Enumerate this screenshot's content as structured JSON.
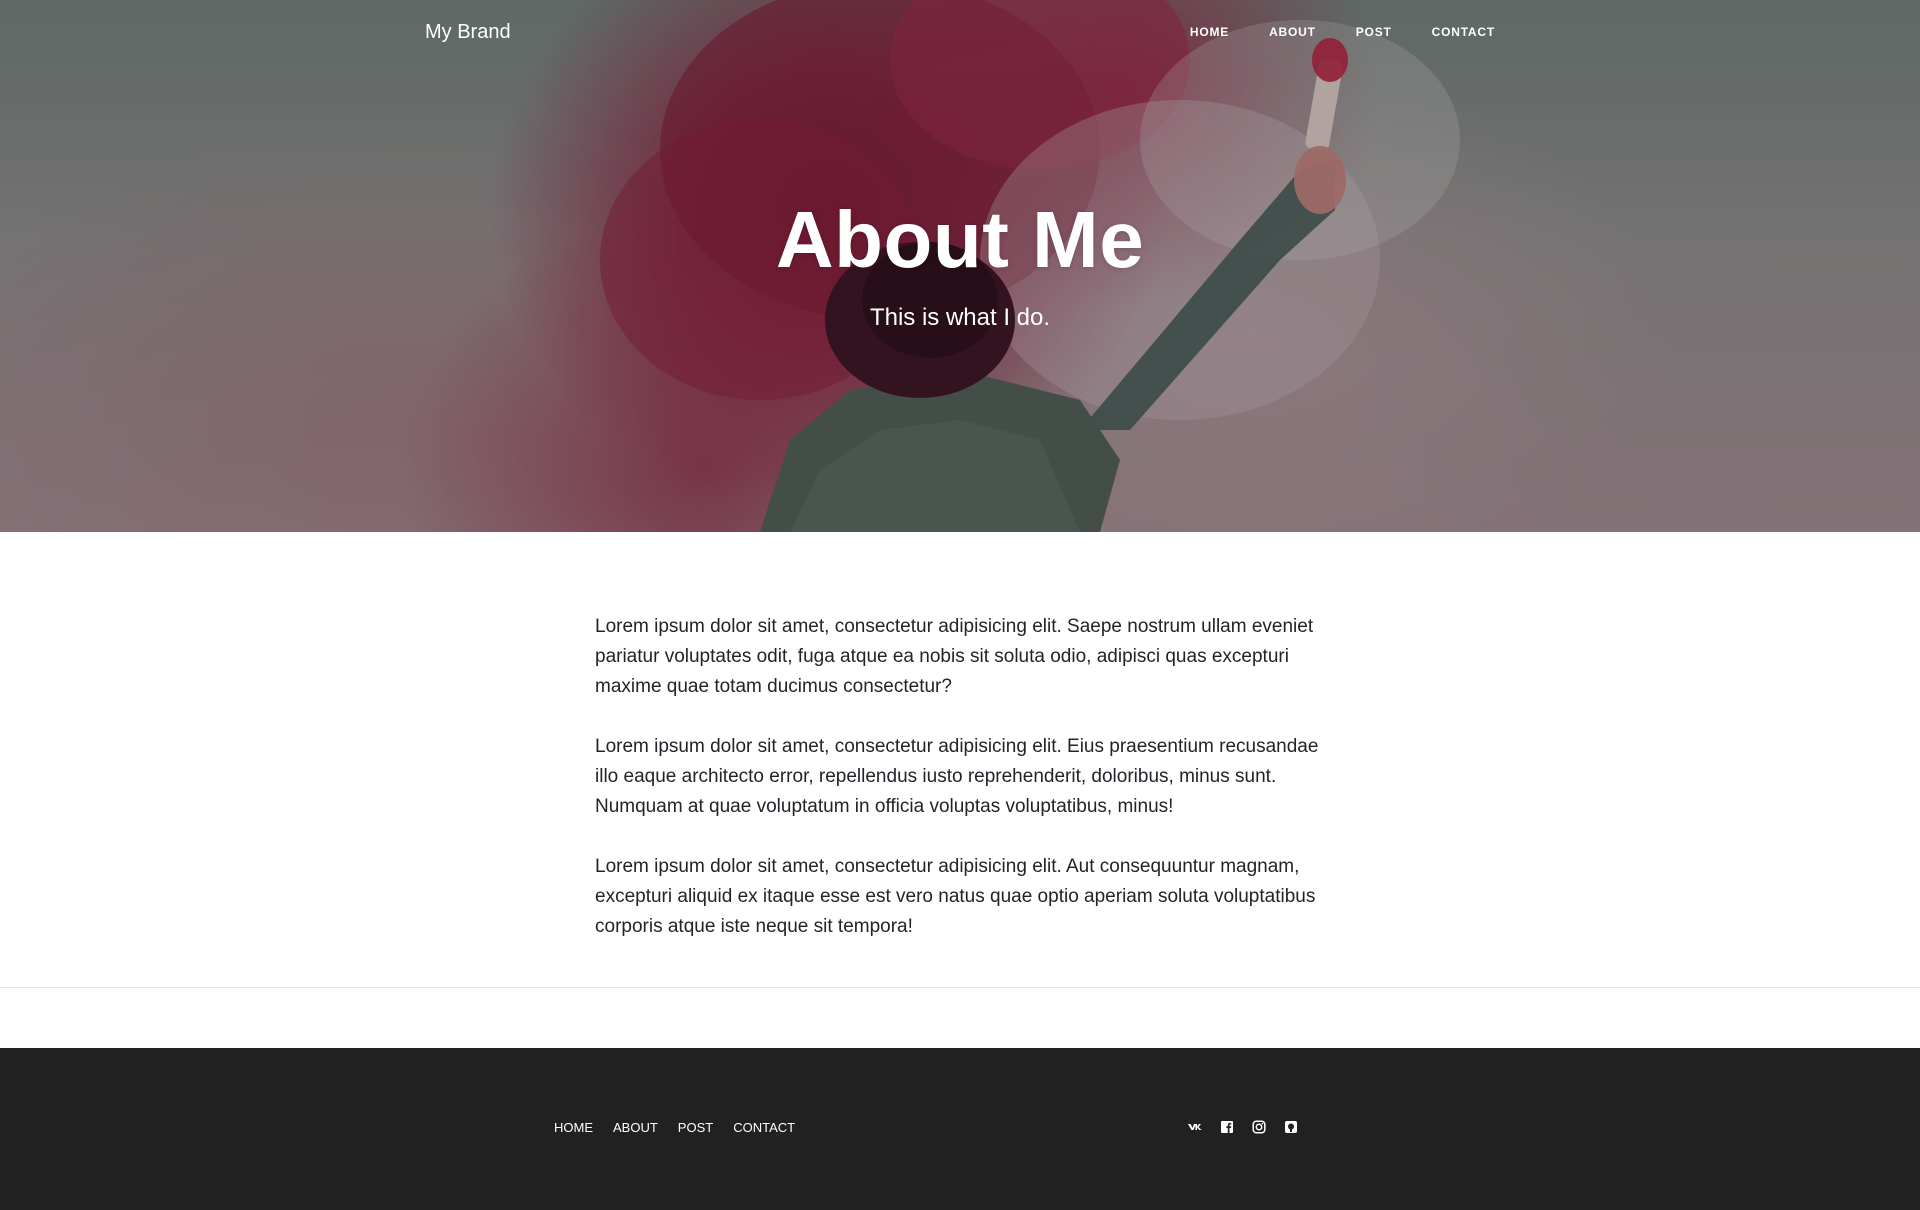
{
  "navbar": {
    "brand": "My Brand",
    "links": [
      "HOME",
      "ABOUT",
      "POST",
      "CONTACT"
    ]
  },
  "hero": {
    "title": "About Me",
    "subtitle": "This is what I do."
  },
  "content": {
    "paragraphs": [
      "Lorem ipsum dolor sit amet, consectetur adipisicing elit. Saepe nostrum ullam eveniet pariatur voluptates odit, fuga atque ea nobis sit soluta odio, adipisci quas excepturi maxime quae totam ducimus consectetur?",
      "Lorem ipsum dolor sit amet, consectetur adipisicing elit. Eius praesentium recusandae illo eaque architecto error, repellendus iusto reprehenderit, doloribus, minus sunt. Numquam at quae voluptatum in officia voluptas voluptatibus, minus!",
      "Lorem ipsum dolor sit amet, consectetur adipisicing elit. Aut consequuntur magnam, excepturi aliquid ex itaque esse est vero natus quae optio aperiam soluta voluptatibus corporis atque iste neque sit tempora!"
    ]
  },
  "footer": {
    "links": [
      "HOME",
      "ABOUT",
      "POST",
      "CONTACT"
    ],
    "social": [
      "vk-icon",
      "facebook-icon",
      "instagram-icon",
      "github-icon"
    ]
  },
  "colors": {
    "footer_bg": "#212121",
    "text": "#212529",
    "hero_accent": "#8c1c3c"
  }
}
